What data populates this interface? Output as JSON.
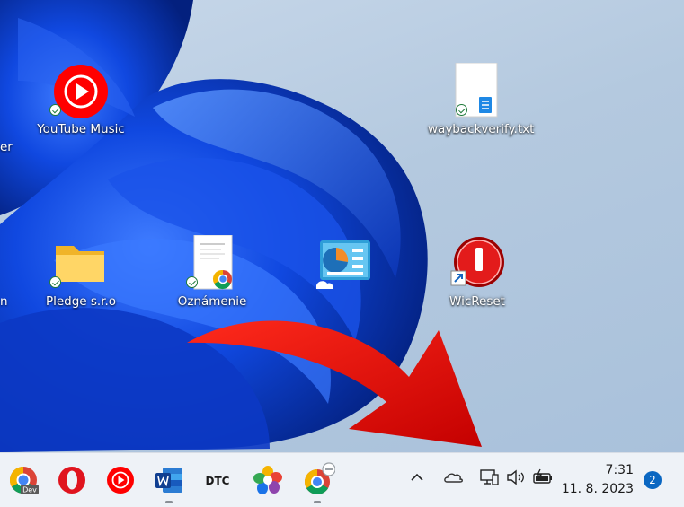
{
  "desktop": {
    "left_edge_labels": [
      "er",
      "n"
    ],
    "icons": [
      {
        "label": "YouTube Music",
        "icon": "youtube-music-icon"
      },
      {
        "label": "waybackverify.txt",
        "icon": "text-file-icon"
      },
      {
        "label": "Pledge s.r.o",
        "icon": "folder-icon"
      },
      {
        "label": "Oznámenie",
        "icon": "chrome-document-icon"
      },
      {
        "label": "",
        "icon": "control-panel-icon"
      },
      {
        "label": "WicReset",
        "icon": "wicreset-icon"
      }
    ]
  },
  "taskbar": {
    "apps": [
      {
        "name": "chrome-dev-icon",
        "badge": "Dev"
      },
      {
        "name": "opera-icon"
      },
      {
        "name": "youtube-music-icon"
      },
      {
        "name": "word-icon",
        "running": true
      },
      {
        "name": "dtc-icon",
        "badge": "DTC"
      },
      {
        "name": "photos-icon"
      },
      {
        "name": "chrome-profile-icon",
        "running": true
      }
    ],
    "tray": {
      "overflow_icon": "chevron-up-icon",
      "icons": [
        "onedrive-cloud-icon",
        "network-icon",
        "volume-icon",
        "battery-icon"
      ]
    },
    "clock": {
      "time": "7:31",
      "date": "11. 8. 2023"
    },
    "notification_count": "2"
  },
  "colors": {
    "taskbar_bg": "#eef2f7",
    "wallpaper_blue": "#0a3fd0",
    "arrow_red": "#e10600",
    "badge_blue": "#0a67c2"
  }
}
